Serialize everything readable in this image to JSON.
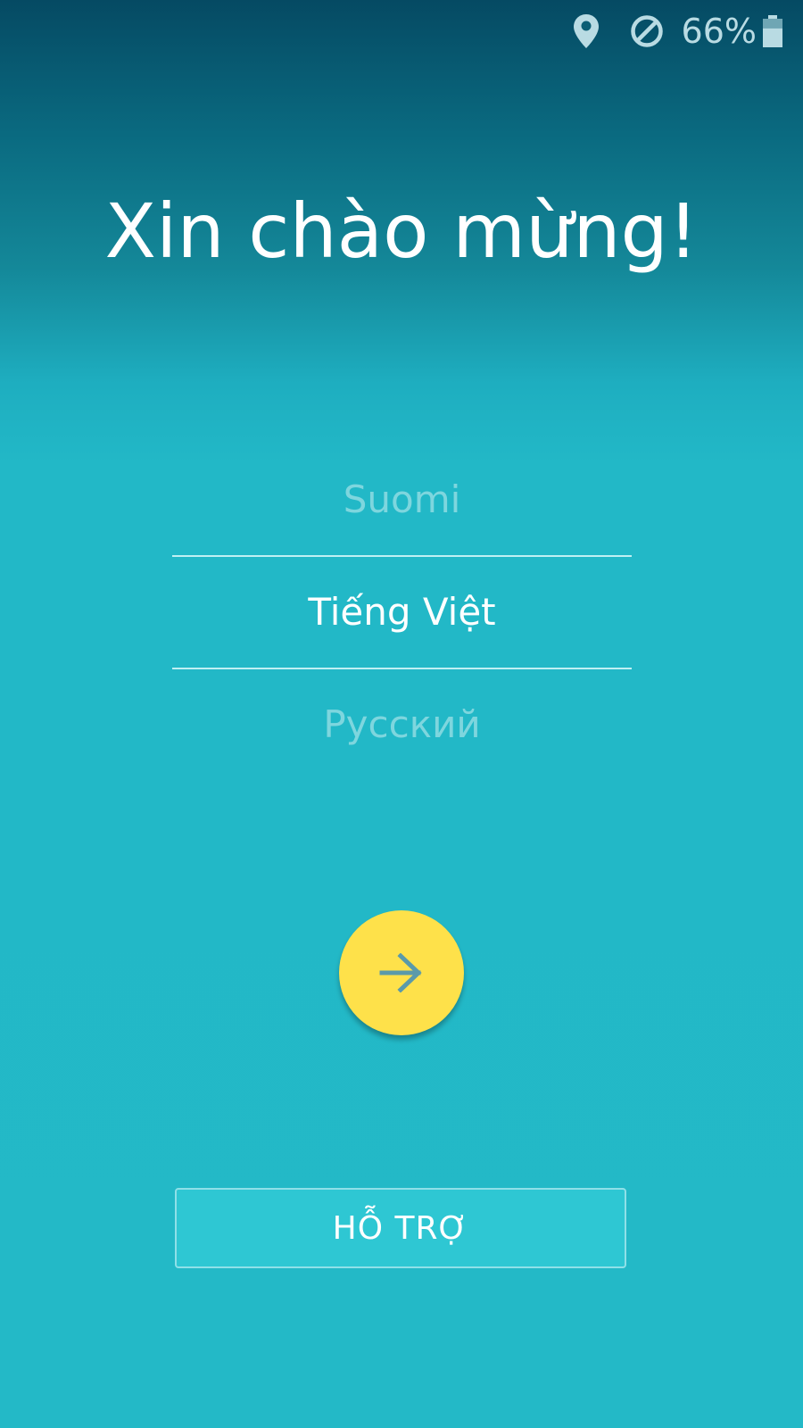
{
  "status_bar": {
    "icons": [
      "location-icon",
      "do-not-disturb-icon",
      "battery-icon"
    ],
    "battery_percent": "66%",
    "battery_level": 0.66,
    "icon_color": "#b9dbe3"
  },
  "welcome": {
    "title": "Xin chào mừng!"
  },
  "language_picker": {
    "options": [
      {
        "label": "Suomi",
        "selected": false
      },
      {
        "label": "Tiếng Việt",
        "selected": true
      },
      {
        "label": "Русский",
        "selected": false
      }
    ]
  },
  "next_button": {
    "icon": "arrow-right-icon",
    "color": "#fee14a"
  },
  "support_button": {
    "label": "HỖ TRỢ"
  },
  "colors": {
    "background_top": "#054a63",
    "background_main": "#23b9c7",
    "accent": "#fee14a"
  }
}
